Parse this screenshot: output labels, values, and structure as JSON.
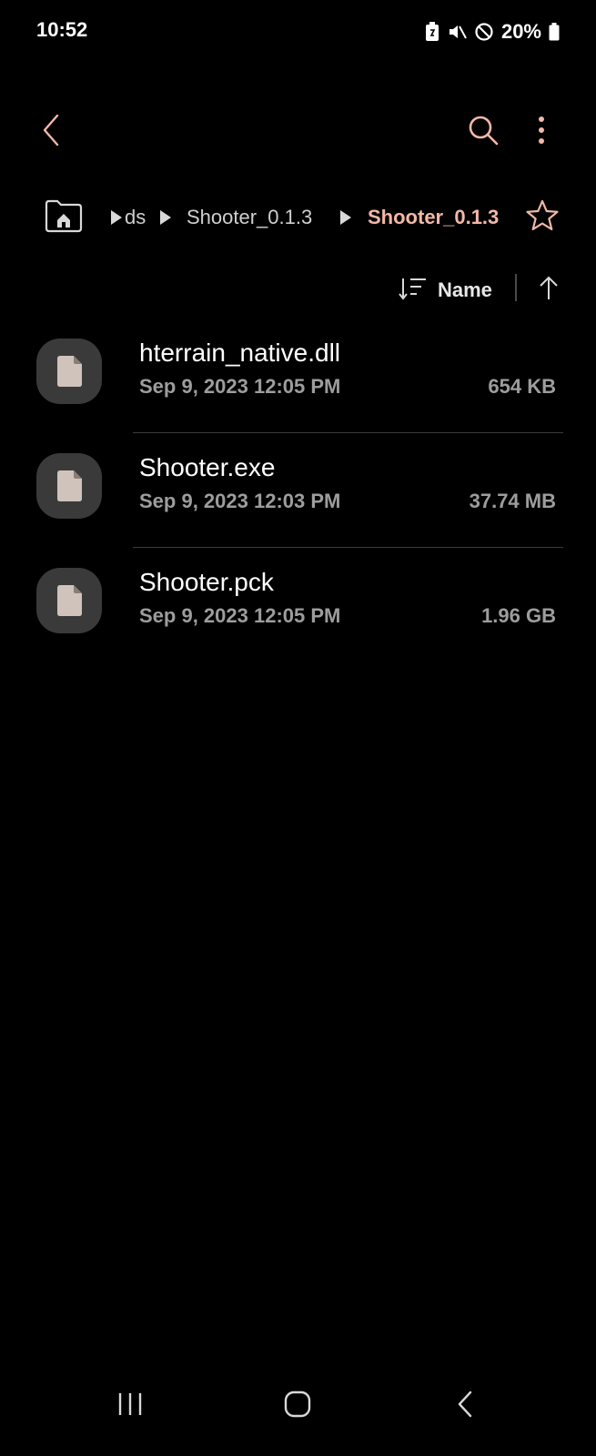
{
  "status_bar": {
    "time": "10:52",
    "battery_percent": "20%",
    "icons": [
      "battery-saver-icon",
      "mute-icon",
      "do-not-disturb-icon",
      "battery-icon"
    ]
  },
  "toolbar": {
    "back_icon": "chevron-left-icon",
    "search_icon": "search-icon",
    "more_icon": "more-vertical-icon"
  },
  "breadcrumb": {
    "home_icon": "home-folder-icon",
    "items": [
      {
        "label": "ds"
      },
      {
        "label": "Shooter_0.1.3"
      },
      {
        "label": "Shooter_0.1.3"
      }
    ],
    "favorite_icon": "star-outline-icon"
  },
  "sort": {
    "label": "Name",
    "sort_icon": "sort-icon",
    "direction_icon": "arrow-up-icon"
  },
  "files": [
    {
      "name": "hterrain_native.dll",
      "date": "Sep 9, 2023 12:05 PM",
      "size": "654 KB"
    },
    {
      "name": "Shooter.exe",
      "date": "Sep 9, 2023 12:03 PM",
      "size": "37.74 MB"
    },
    {
      "name": "Shooter.pck",
      "date": "Sep 9, 2023 12:05 PM",
      "size": "1.96 GB"
    }
  ],
  "nav_bar": {
    "recents_icon": "recents-icon",
    "home_icon": "home-icon",
    "back_icon": "back-icon"
  },
  "colors": {
    "accent": "#f2b8a8",
    "background": "#000000",
    "secondary_text": "#9d9d9d"
  }
}
